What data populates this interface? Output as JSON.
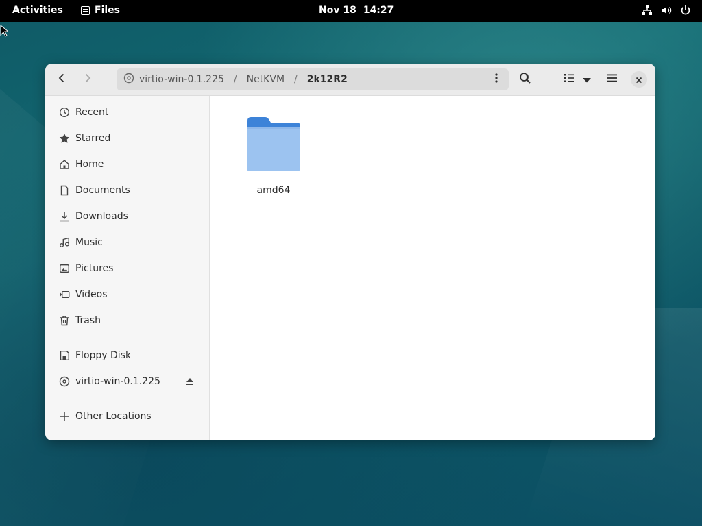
{
  "topbar": {
    "activities": "Activities",
    "app_name": "Files",
    "date": "Nov 18",
    "time": "14:27",
    "tray_icons": [
      "network-icon",
      "volume-icon",
      "power-icon"
    ]
  },
  "window": {
    "path": [
      "virtio-win-0.1.225",
      "NetKVM",
      "2k12R2"
    ],
    "path_separator": "/",
    "toolbar_icons": [
      "back-icon",
      "forward-icon",
      "search-icon",
      "list-view-icon",
      "view-options-icon",
      "menu-icon",
      "close-icon"
    ]
  },
  "sidebar": {
    "places": [
      {
        "label": "Recent",
        "icon": "clock-icon"
      },
      {
        "label": "Starred",
        "icon": "star-icon"
      },
      {
        "label": "Home",
        "icon": "home-icon"
      },
      {
        "label": "Documents",
        "icon": "document-icon"
      },
      {
        "label": "Downloads",
        "icon": "download-icon"
      },
      {
        "label": "Music",
        "icon": "music-icon"
      },
      {
        "label": "Pictures",
        "icon": "picture-icon"
      },
      {
        "label": "Videos",
        "icon": "video-icon"
      },
      {
        "label": "Trash",
        "icon": "trash-icon"
      }
    ],
    "devices": [
      {
        "label": "Floppy Disk",
        "icon": "floppy-icon"
      },
      {
        "label": "virtio-win-0.1.225",
        "icon": "disc-icon",
        "ejectable": true
      }
    ],
    "other": {
      "label": "Other Locations",
      "icon": "plus-icon"
    }
  },
  "content": {
    "items": [
      {
        "name": "amd64",
        "type": "folder"
      }
    ]
  },
  "colors": {
    "folder_top": "#3d83d8",
    "folder_body": "#9cc3f0",
    "headerbar": "#ebebeb",
    "sidebar": "#f6f6f6"
  }
}
